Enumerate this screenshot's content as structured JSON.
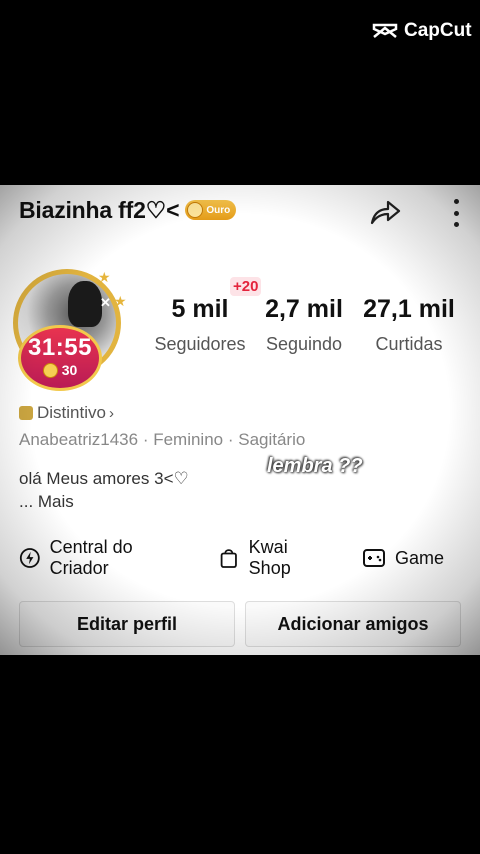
{
  "watermark": {
    "label": "CapCut",
    "icon": "capcut-logo-icon"
  },
  "profile": {
    "name": "Biazinha ff2♡<",
    "badge_label": "Ouro",
    "live_time": "31:55",
    "live_coins": "30",
    "distintivo_label": "Distintivo",
    "meta": "Anabeatriz1436 · Feminino · Sagitário",
    "bio": "olá Meus amores  3<♡",
    "more_label": "...  Mais",
    "overlay_text": "lembra ??"
  },
  "stats": {
    "followers_delta": "+20",
    "items": [
      {
        "value": "5 mil",
        "label": "Seguidores"
      },
      {
        "value": "2,7 mil",
        "label": "Seguindo"
      },
      {
        "value": "27,1 mil",
        "label": "Curtidas"
      }
    ]
  },
  "shortcuts": [
    {
      "label": "Central do Criador",
      "icon": "lightning-icon"
    },
    {
      "label": "Kwai Shop",
      "icon": "shopping-bag-icon"
    },
    {
      "label": "Game",
      "icon": "gamepad-icon"
    }
  ],
  "buttons": {
    "edit": "Editar perfil",
    "add_friends": "Adicionar amigos"
  },
  "colors": {
    "gold": "#e2b43f",
    "live_red": "#e8334f",
    "delta_red": "#e4233c"
  }
}
